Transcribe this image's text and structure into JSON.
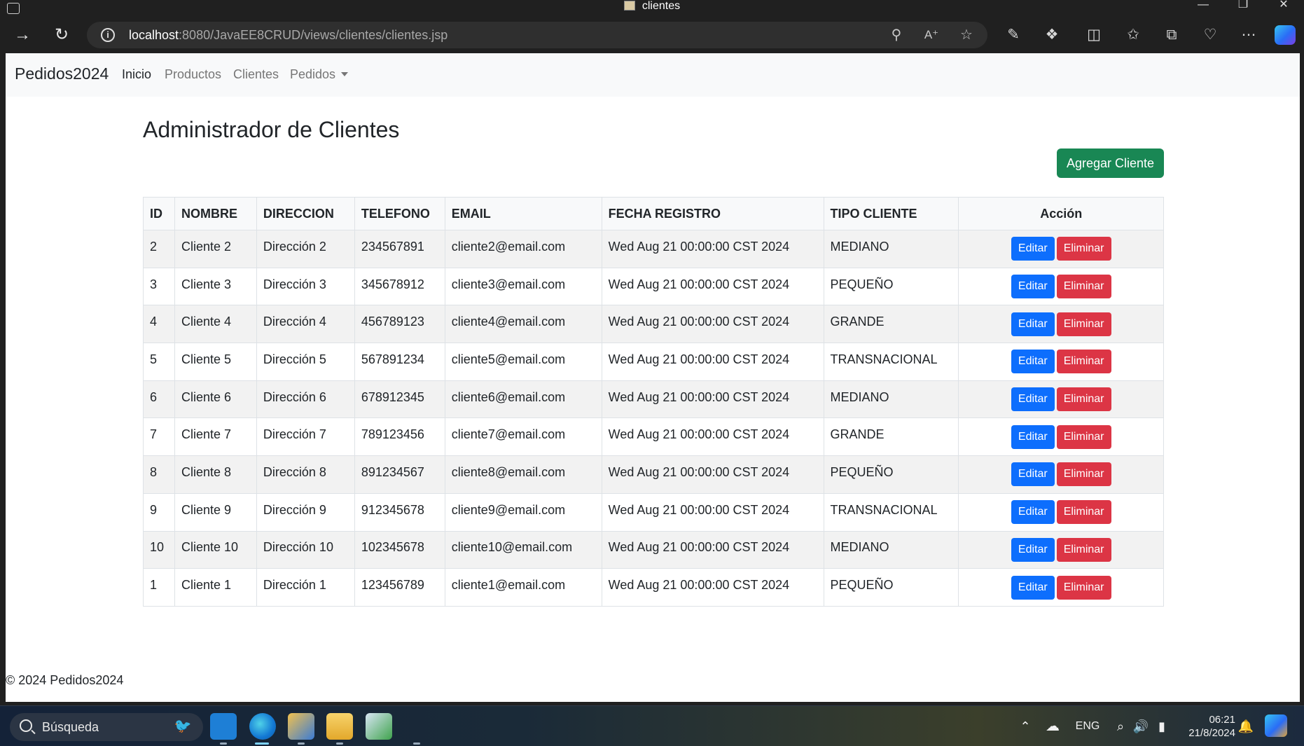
{
  "window": {
    "title": "clientes"
  },
  "browser": {
    "url_host": "localhost",
    "url_rest": ":8080/JavaEE8CRUD/views/clientes/clientes.jsp"
  },
  "navbar": {
    "brand": "Pedidos2024",
    "links": [
      {
        "label": "Inicio",
        "active": true
      },
      {
        "label": "Productos",
        "active": false
      },
      {
        "label": "Clientes",
        "active": false
      },
      {
        "label": "Pedidos",
        "active": false,
        "dropdown": true
      }
    ]
  },
  "main": {
    "title": "Administrador de Clientes",
    "add_button": "Agregar Cliente",
    "table": {
      "headers": [
        "ID",
        "NOMBRE",
        "DIRECCION",
        "TELEFONO",
        "EMAIL",
        "FECHA REGISTRO",
        "TIPO CLIENTE",
        "Acción"
      ],
      "edit_label": "Editar",
      "delete_label": "Eliminar",
      "rows": [
        [
          "2",
          "Cliente 2",
          "Dirección 2",
          "234567891",
          "cliente2@email.com",
          "Wed Aug 21 00:00:00 CST 2024",
          "MEDIANO"
        ],
        [
          "3",
          "Cliente 3",
          "Dirección 3",
          "345678912",
          "cliente3@email.com",
          "Wed Aug 21 00:00:00 CST 2024",
          "PEQUEÑO"
        ],
        [
          "4",
          "Cliente 4",
          "Dirección 4",
          "456789123",
          "cliente4@email.com",
          "Wed Aug 21 00:00:00 CST 2024",
          "GRANDE"
        ],
        [
          "5",
          "Cliente 5",
          "Dirección 5",
          "567891234",
          "cliente5@email.com",
          "Wed Aug 21 00:00:00 CST 2024",
          "TRANSNACIONAL"
        ],
        [
          "6",
          "Cliente 6",
          "Dirección 6",
          "678912345",
          "cliente6@email.com",
          "Wed Aug 21 00:00:00 CST 2024",
          "MEDIANO"
        ],
        [
          "7",
          "Cliente 7",
          "Dirección 7",
          "789123456",
          "cliente7@email.com",
          "Wed Aug 21 00:00:00 CST 2024",
          "GRANDE"
        ],
        [
          "8",
          "Cliente 8",
          "Dirección 8",
          "891234567",
          "cliente8@email.com",
          "Wed Aug 21 00:00:00 CST 2024",
          "PEQUEÑO"
        ],
        [
          "9",
          "Cliente 9",
          "Dirección 9",
          "912345678",
          "cliente9@email.com",
          "Wed Aug 21 00:00:00 CST 2024",
          "TRANSNACIONAL"
        ],
        [
          "10",
          "Cliente 10",
          "Dirección 10",
          "102345678",
          "cliente10@email.com",
          "Wed Aug 21 00:00:00 CST 2024",
          "MEDIANO"
        ],
        [
          "1",
          "Cliente 1",
          "Dirección 1",
          "123456789",
          "cliente1@email.com",
          "Wed Aug 21 00:00:00 CST 2024",
          "PEQUEÑO"
        ]
      ]
    }
  },
  "footer": {
    "text": "© 2024 Pedidos2024"
  },
  "taskbar": {
    "search_placeholder": "Búsqueda",
    "language": "ENG",
    "time": "06:21",
    "date": "21/8/2024"
  },
  "colors": {
    "add_button": "#198754",
    "edit_button": "#0d6efd",
    "delete_button": "#dc3545",
    "navbar_bg": "#f8f9fa",
    "striped_row": "#f2f2f2"
  }
}
